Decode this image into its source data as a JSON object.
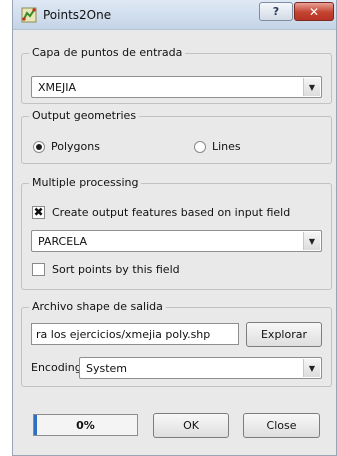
{
  "window": {
    "title": "Points2One"
  },
  "titlebar": {
    "help_label": "?",
    "close_label": "✕"
  },
  "input_layer": {
    "group_title": "Capa de puntos de entrada",
    "selected": "XMEJIA"
  },
  "output_geometries": {
    "group_title": "Output geometries",
    "options": [
      {
        "label": "Polygons",
        "checked": true
      },
      {
        "label": "Lines",
        "checked": false
      }
    ]
  },
  "multiple_processing": {
    "group_title": "Multiple processing",
    "create_by_field_label": "Create output features based on input field",
    "create_by_field_checked": true,
    "field_selected": "PARCELA",
    "sort_label": "Sort points by this field",
    "sort_checked": false
  },
  "output_file": {
    "group_title": "Archivo shape de salida",
    "path_value": "ra los ejercicios/xmejia poly.shp",
    "browse_label": "Explorar",
    "encoding_label": "Encoding",
    "encoding_value": "System"
  },
  "footer": {
    "progress_text": "0%",
    "progress_value": 0.03,
    "ok_label": "OK",
    "close_label": "Close"
  },
  "colors": {
    "progress_fill": "#2d70c2",
    "close_button": "#c44230"
  }
}
